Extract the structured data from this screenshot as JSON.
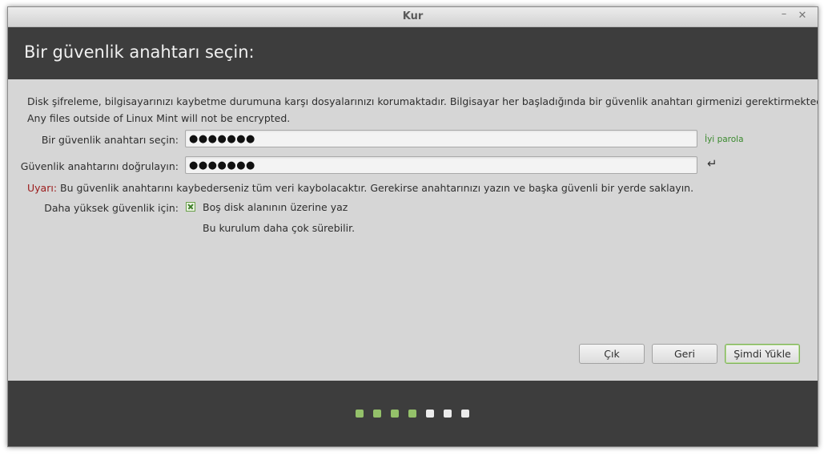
{
  "window": {
    "title": "Kur",
    "minimize_glyph": "–",
    "close_glyph": "✕"
  },
  "header": {
    "title": "Bir güvenlik anahtarı seçin:"
  },
  "content": {
    "description_line1": "Disk şifreleme, bilgisayarınızı kaybetme durumuna karşı dosyalarınızı korumaktadır. Bilgisayar her başladığında bir güvenlik anahtarı girmenizi gerektirmektedir.",
    "description_line2": "Any files outside of Linux Mint will not be encrypted.",
    "key_label": "Bir güvenlik anahtarı seçin:",
    "key_value": "●●●●●●●",
    "strength_text": "İyi parola",
    "confirm_label": "Güvenlik anahtarını doğrulayın:",
    "confirm_value": "●●●●●●●",
    "match_icon": "↵",
    "warning_prefix": "Uyarı:",
    "warning_text": " Bu güvenlik anahtarını kaybederseniz tüm veri kaybolacaktır. Gerekirse anahtarınızı yazın ve başka güvenli bir yerde saklayın.",
    "security_label": "Daha yüksek güvenlik için:",
    "overwrite_label": "Boş disk alanının üzerine yaz",
    "overwrite_checked": true,
    "overwrite_note": "Bu kurulum daha çok sürebilir."
  },
  "buttons": {
    "quit": "Çık",
    "back": "Geri",
    "install": "Şimdi Yükle"
  },
  "progress": {
    "total_steps": 7,
    "completed_steps": 4,
    "done_color": "#94c16a",
    "todo_color": "#ececec"
  },
  "colors": {
    "header_bg": "#3d3d3d",
    "accent_green": "#3b8a2e",
    "warning_red": "#9b1b1b"
  }
}
